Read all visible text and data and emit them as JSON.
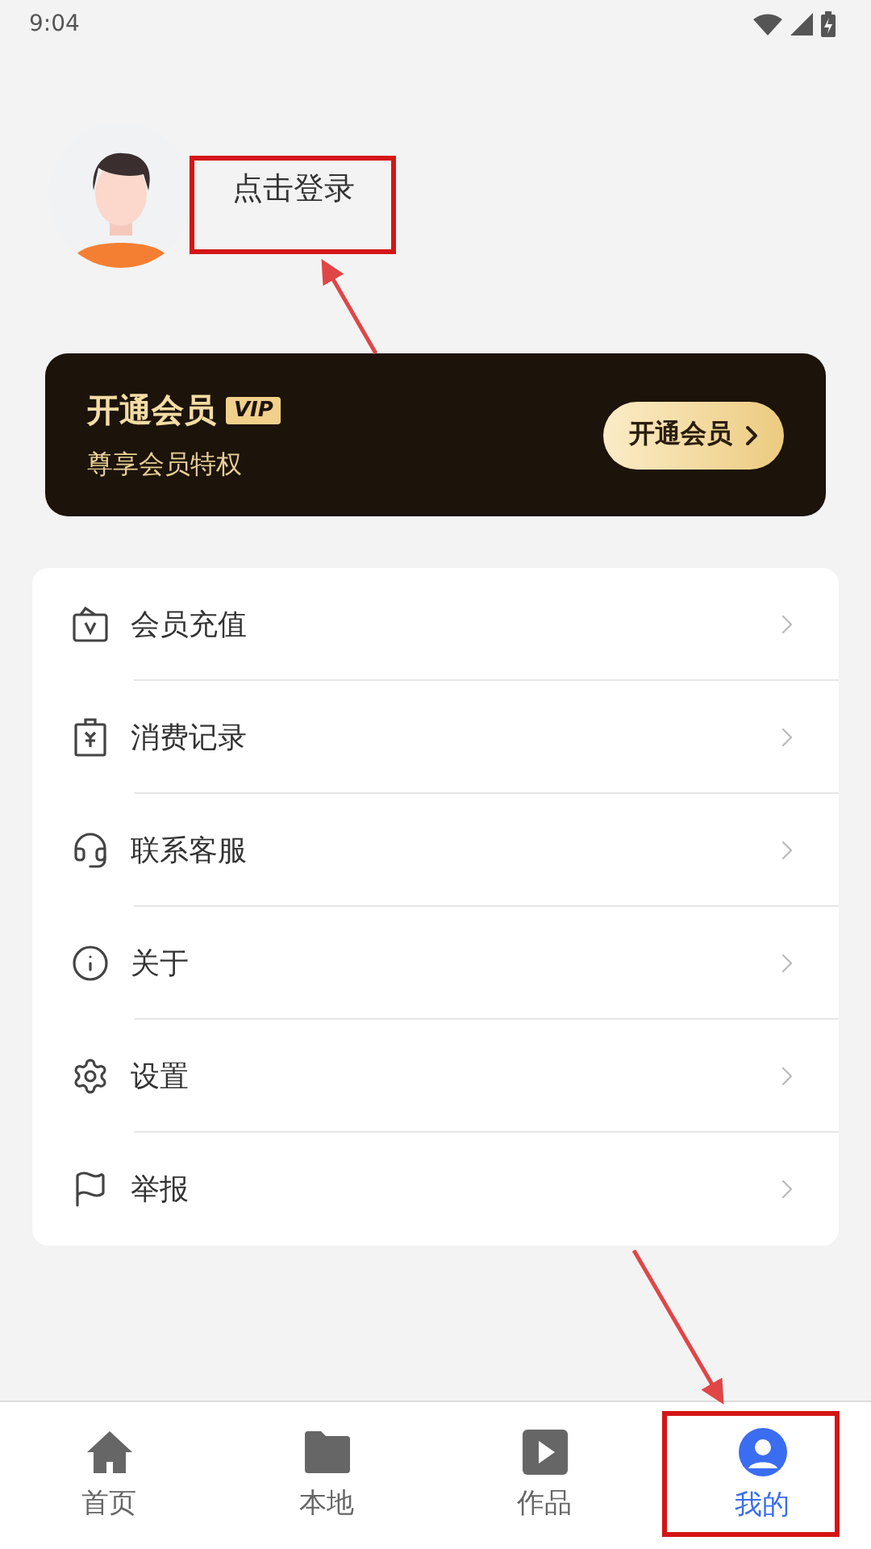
{
  "status_bar": {
    "time": "9:04"
  },
  "profile": {
    "login_label": "点击登录"
  },
  "vip_card": {
    "title": "开通会员",
    "badge": "VIP",
    "subtitle": "尊享会员特权",
    "button": "开通会员"
  },
  "menu": [
    {
      "kind": "recharge",
      "label": "会员充值"
    },
    {
      "kind": "records",
      "label": "消费记录"
    },
    {
      "kind": "service",
      "label": "联系客服"
    },
    {
      "kind": "about",
      "label": "关于"
    },
    {
      "kind": "settings",
      "label": "设置"
    },
    {
      "kind": "report",
      "label": "举报"
    }
  ],
  "tabs": [
    {
      "kind": "home",
      "label": "首页",
      "selected": false
    },
    {
      "kind": "local",
      "label": "本地",
      "selected": false
    },
    {
      "kind": "works",
      "label": "作品",
      "selected": false
    },
    {
      "kind": "mine",
      "label": "我的",
      "selected": true
    }
  ]
}
